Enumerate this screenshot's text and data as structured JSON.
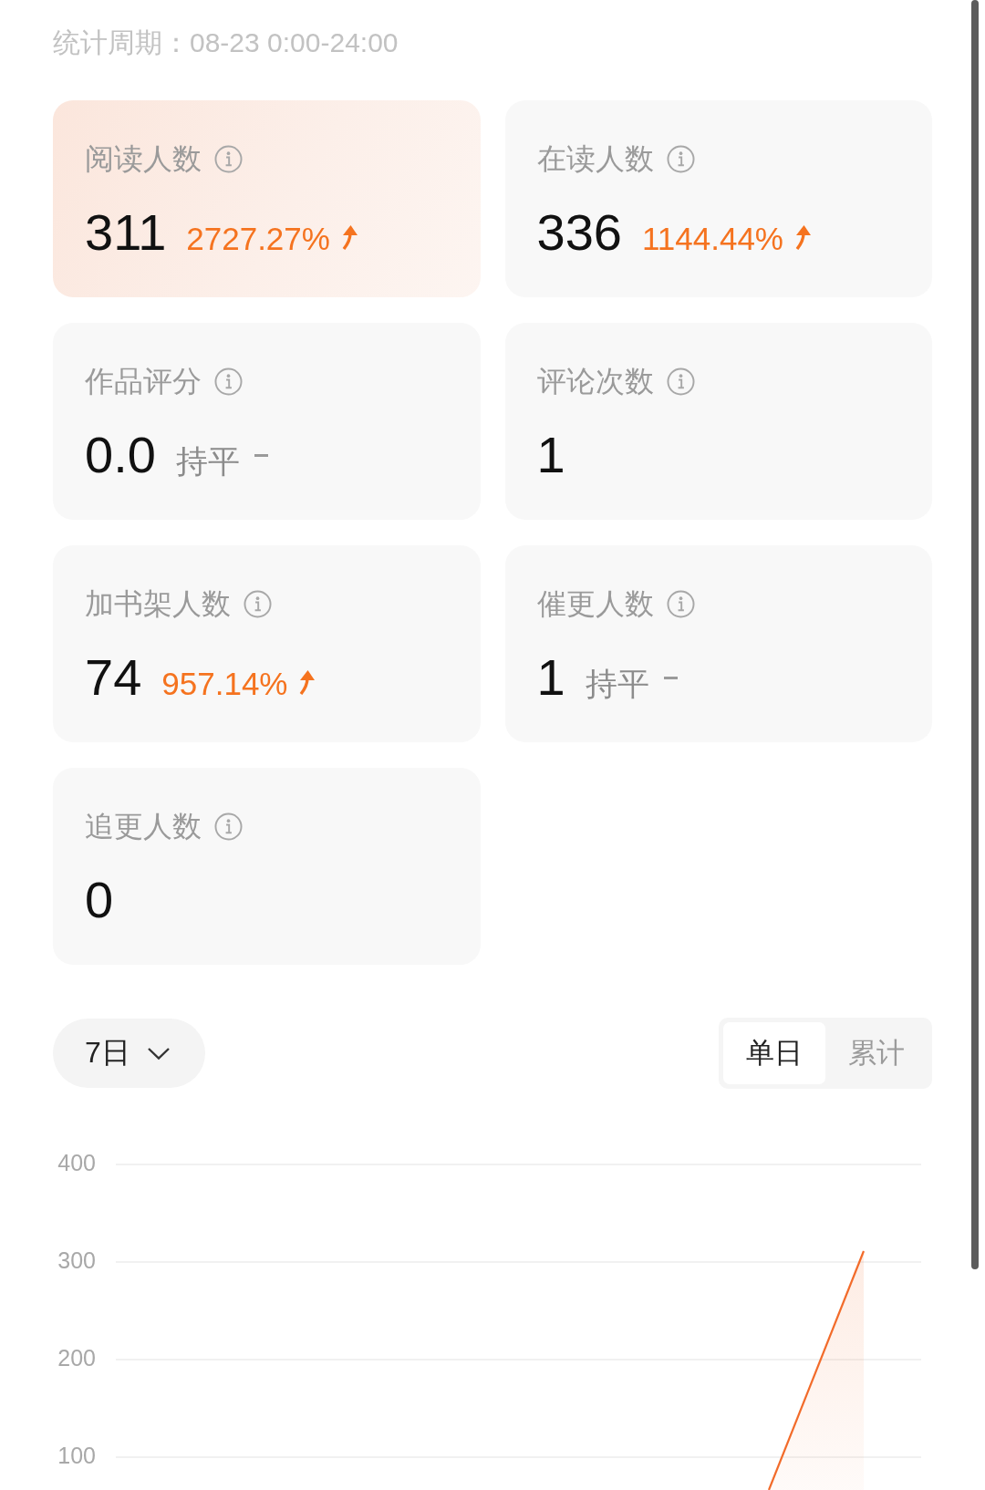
{
  "period": "统计周期：08-23 0:00-24:00",
  "metrics": [
    {
      "kind": "rise",
      "label": "阅读人数",
      "value": "311",
      "change": "2727.27%",
      "selected": true
    },
    {
      "kind": "rise",
      "label": "在读人数",
      "value": "336",
      "change": "1144.44%",
      "selected": false
    },
    {
      "kind": "flat",
      "label": "作品评分",
      "value": "0.0",
      "change": "持平",
      "selected": false
    },
    {
      "kind": "plain",
      "label": "评论次数",
      "value": "1",
      "selected": false
    },
    {
      "kind": "rise",
      "label": "加书架人数",
      "value": "74",
      "change": "957.14%",
      "selected": false
    },
    {
      "kind": "flat",
      "label": "催更人数",
      "value": "1",
      "change": "持平",
      "selected": false
    },
    {
      "kind": "plain",
      "label": "追更人数",
      "value": "0",
      "selected": false
    }
  ],
  "range_select": {
    "label": "7日"
  },
  "mode_toggle": [
    {
      "label": "单日",
      "selected": true
    },
    {
      "label": "累计",
      "selected": false
    }
  ],
  "chart": {
    "y_labels": [
      "400",
      "300",
      "200",
      "100"
    ]
  }
}
